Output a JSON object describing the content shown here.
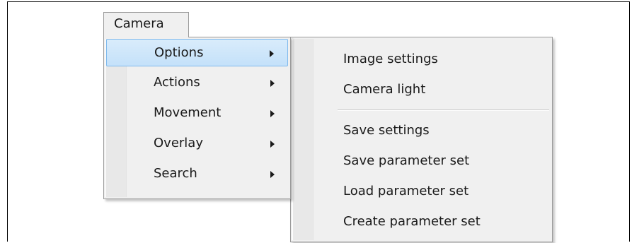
{
  "menubar": {
    "camera_label": "Camera"
  },
  "main_menu": {
    "items": [
      {
        "label": "Options",
        "highlighted": true,
        "has_submenu": true
      },
      {
        "label": "Actions",
        "has_submenu": true
      },
      {
        "label": "Movement",
        "has_submenu": true
      },
      {
        "label": "Overlay",
        "has_submenu": true
      },
      {
        "label": "Search",
        "has_submenu": true
      }
    ]
  },
  "options_submenu": {
    "items": [
      {
        "label": "Image settings"
      },
      {
        "label": "Camera light"
      },
      {
        "label": "Save settings"
      },
      {
        "label": "Save parameter set"
      },
      {
        "label": "Load parameter set"
      },
      {
        "label": "Create parameter set"
      }
    ]
  },
  "colors": {
    "highlight_fill": "#c9e3fa",
    "highlight_border": "#7fb9ec",
    "menu_background": "#f0f0f0"
  }
}
